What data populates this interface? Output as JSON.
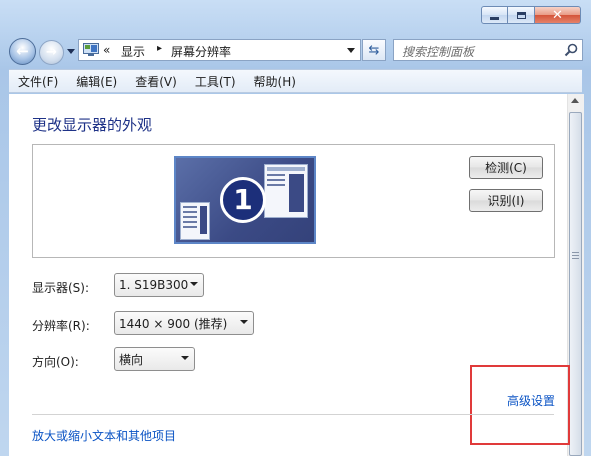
{
  "nav": {
    "breadcrumb_prefix": "«",
    "breadcrumb_display": "显示",
    "breadcrumb_sep": "▸",
    "breadcrumb_current": "屏幕分辨率",
    "search_placeholder": "搜索控制面板"
  },
  "menu": {
    "items": [
      "文件(F)",
      "编辑(E)",
      "查看(V)",
      "工具(T)",
      "帮助(H)"
    ]
  },
  "main": {
    "title": "更改显示器的外观",
    "monitor_number": "1",
    "detect_label": "检测(C)",
    "identify_label": "识别(I)",
    "display_label": "显示器(S):",
    "display_value": "1. S19B300",
    "resolution_label": "分辨率(R):",
    "resolution_value": "1440 × 900 (推荐)",
    "orientation_label": "方向(O):",
    "orientation_value": "横向",
    "advanced_link": "高级设置",
    "text_size_link": "放大或缩小文本和其他项目"
  },
  "colors": {
    "highlight": "#e03a3a",
    "link": "#0a53c4",
    "title": "#1e3287"
  }
}
